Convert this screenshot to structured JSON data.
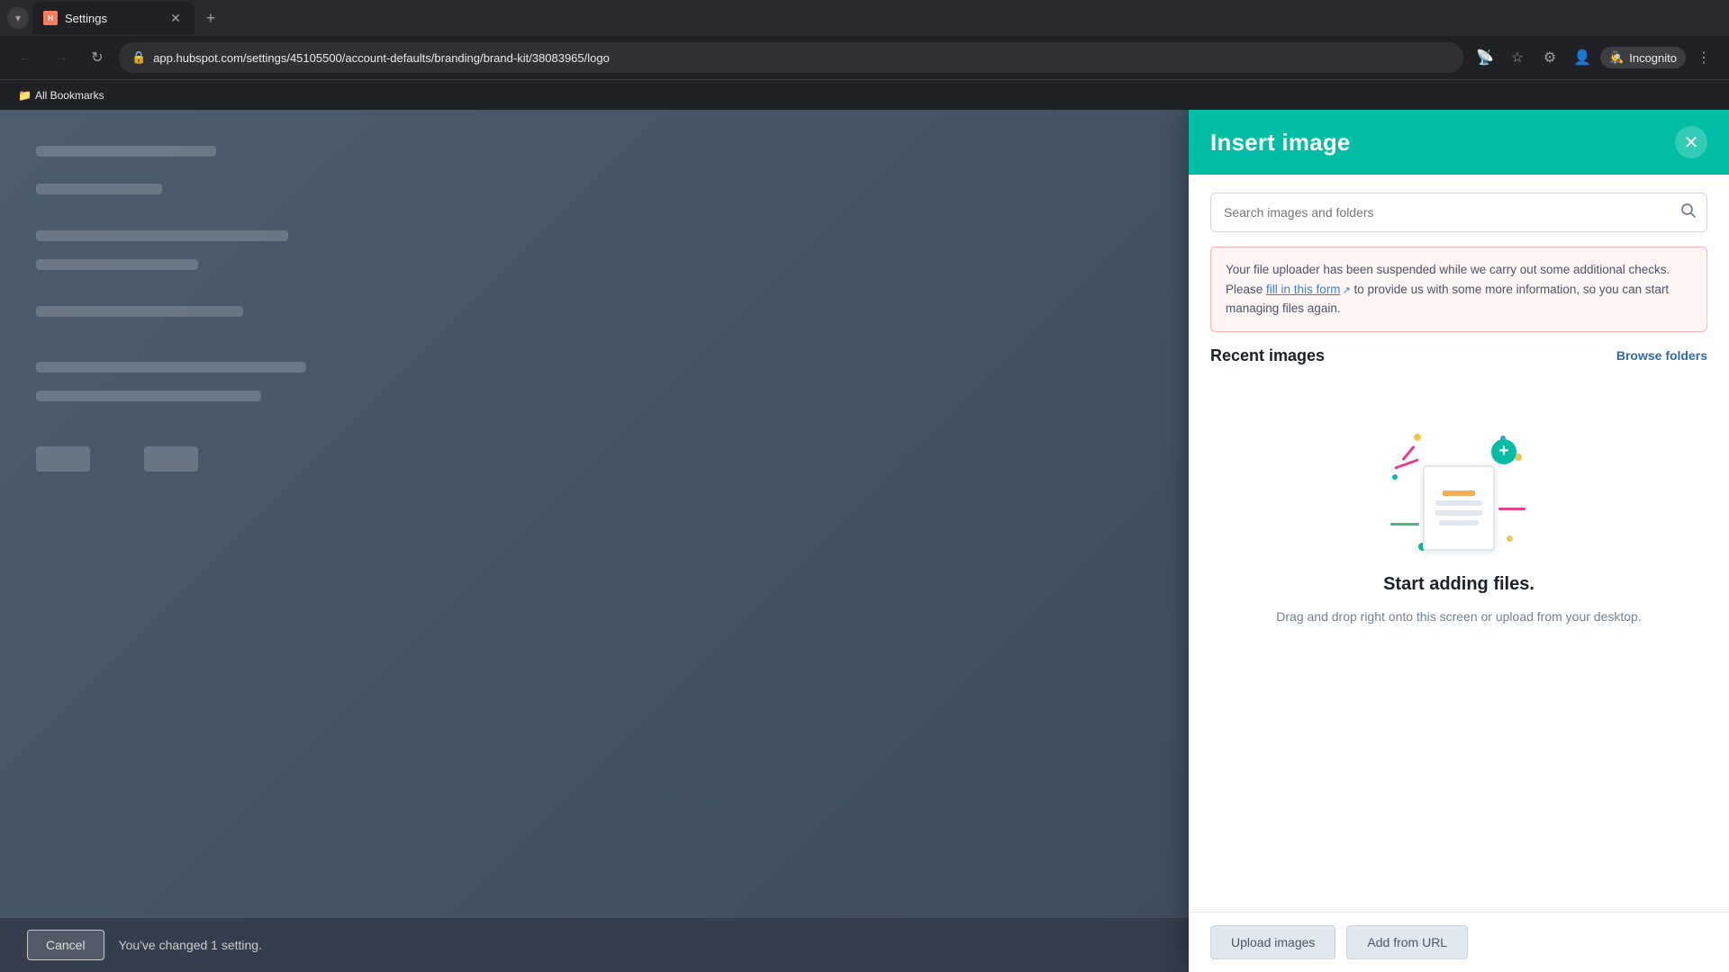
{
  "browser": {
    "tab_title": "Settings",
    "favicon_letter": "H",
    "url": "app.hubspot.com/settings/45105500/account-defaults/branding/brand-kit/38083965/logo",
    "url_full": "app.hubspot.com/settings/45105500/account-defaults/branding/brand-kit/38083965/logo",
    "incognito_label": "Incognito",
    "bookmarks_label": "All Bookmarks"
  },
  "bottom_bar": {
    "cancel_label": "Cancel",
    "changed_text": "You've changed 1 setting."
  },
  "modal": {
    "title": "Insert image",
    "close_icon": "✕",
    "search_placeholder": "Search images and folders",
    "warning_text_before": "Your file uploader has been suspended while we carry out some additional checks. Please ",
    "warning_link": "fill in this form",
    "warning_text_after": " to provide us with some more information, so you can start managing files again.",
    "section_title": "Recent images",
    "browse_folders_label": "Browse folders",
    "empty_title": "Start adding files.",
    "empty_subtitle": "Drag and drop right onto this screen or upload from your desktop.",
    "upload_btn_label": "Upload images",
    "url_btn_label": "Add from URL"
  }
}
